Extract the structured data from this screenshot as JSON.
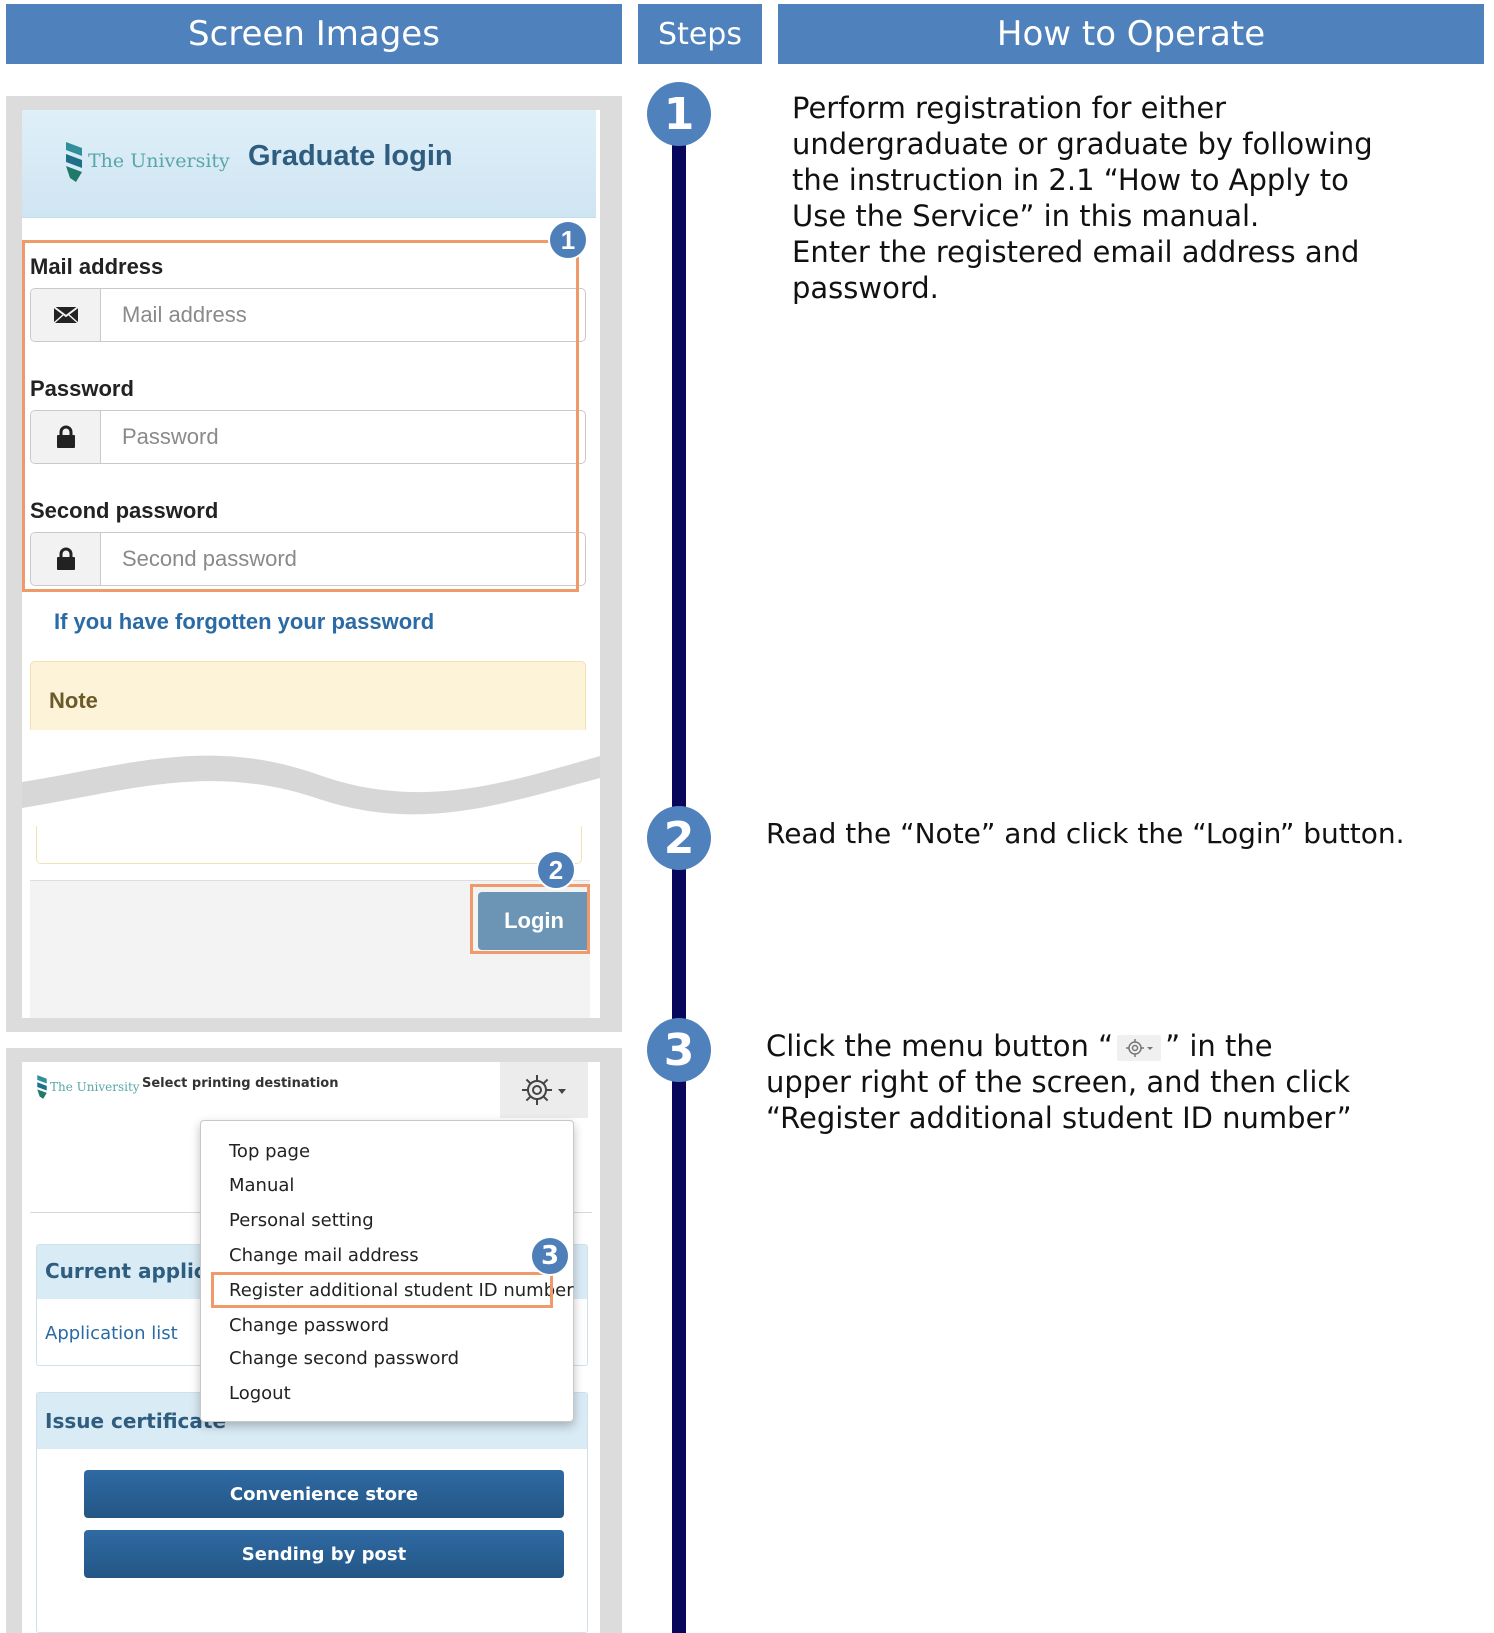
{
  "headers": {
    "screen_images": "Screen Images",
    "steps": "Steps",
    "how_to_operate": "How to Operate"
  },
  "login_screen": {
    "logo_text": "The University",
    "title": "Graduate login",
    "mail_label": "Mail address",
    "mail_placeholder": "Mail address",
    "password_label": "Password",
    "password_placeholder": "Password",
    "second_password_label": "Second password",
    "second_password_placeholder": "Second password",
    "forgot_link": "If you have forgotten your password",
    "note_label": "Note",
    "login_button": "Login",
    "badge_1": "1",
    "badge_2": "2"
  },
  "menu_screen": {
    "logo_text": "The University",
    "page_title": "Select printing destination",
    "menu_items": [
      "Top page",
      "Manual",
      "Personal setting",
      "Change mail address",
      "Register additional student ID number",
      "Change password",
      "Change second password",
      "Logout"
    ],
    "current_application": "Current applicatio",
    "application_list": "Application list",
    "issue_certificate": "Issue certificate",
    "convenience_store": "Convenience store",
    "sending_by_post": "Sending by post",
    "badge_3": "3"
  },
  "steps": [
    {
      "number": "1",
      "lines": [
        "Perform registration for either",
        "undergraduate or graduate by following",
        "the instruction in 2.1 “How to Apply to",
        "Use the Service” in this manual.",
        "Enter the registered email address and",
        "password."
      ]
    },
    {
      "number": "2",
      "lines": [
        "Read the “Note” and click the “Login” button."
      ]
    },
    {
      "number": "3",
      "line1_before": "Click the menu button “",
      "line1_after": "” in the",
      "lines": [
        "upper right of the screen, and then click",
        "“Register additional student ID number”"
      ]
    }
  ],
  "colors": {
    "header_blue": "#4f81bd",
    "timeline_navy": "#07085c",
    "highlight_orange": "#f09a6c",
    "link_blue": "#2a6aa5"
  }
}
